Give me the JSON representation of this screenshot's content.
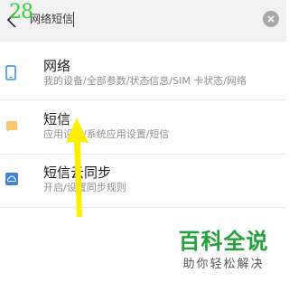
{
  "overlay": {
    "step_number": "28"
  },
  "search": {
    "query": "网络短信"
  },
  "results": [
    {
      "icon": "phone-icon",
      "title": "网络",
      "subtitle": "我的设备/全部参数/状态信息/SIM 卡状态/网络"
    },
    {
      "icon": "message-icon",
      "title": "短信",
      "subtitle": "应用设置/系统应用设置/短信"
    },
    {
      "icon": "cloud-sync-icon",
      "title": "短信云同步",
      "subtitle": "开启/设置同步规则"
    }
  ],
  "watermark": {
    "title": "百科全说",
    "subtitle": "助你轻松解决"
  },
  "colors": {
    "accent_green": "#22a33a",
    "step_green": "#2fd12f",
    "annotation_yellow": "#ffee00",
    "phone_icon": "#2f8ee0",
    "message_icon": "#f7c96b",
    "cloud_icon": "#3f83d6"
  }
}
